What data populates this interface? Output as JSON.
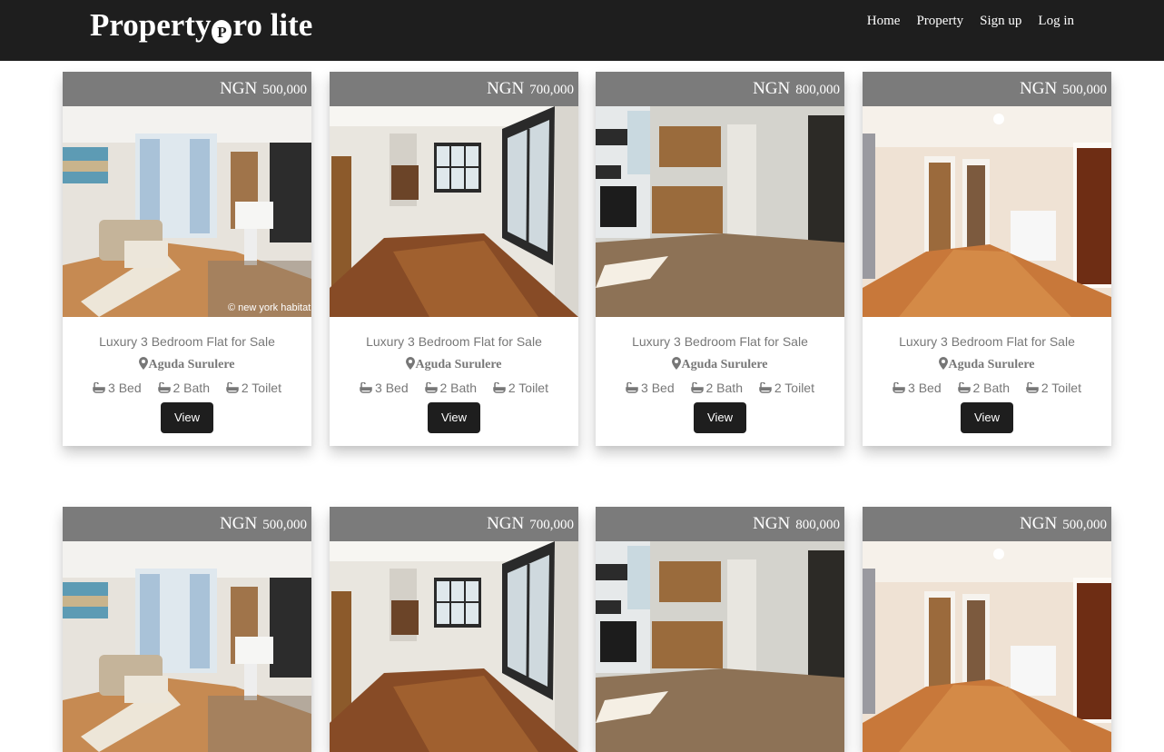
{
  "brand": {
    "before": "Property",
    "badge": "P",
    "after": "ro lite"
  },
  "nav": {
    "home": "Home",
    "property": "Property",
    "signup": "Sign up",
    "login": "Log in"
  },
  "colors": {
    "navbar": "#1e1e1e",
    "price_bar": "#7b7b7b",
    "text_muted": "#777777",
    "button": "#1e1e1e"
  },
  "listings": [
    {
      "currency": "NGN",
      "price": "500,000",
      "title": "Luxury 3 Bedroom Flat for Sale",
      "location": "Aguda Surulere",
      "bed": "3 Bed",
      "bath": "2 Bath",
      "toilet": "2 Toilet",
      "button": "View",
      "watermark": "© new york habitat"
    },
    {
      "currency": "NGN",
      "price": "700,000",
      "title": "Luxury 3 Bedroom Flat for Sale",
      "location": "Aguda Surulere",
      "bed": "3 Bed",
      "bath": "2 Bath",
      "toilet": "2 Toilet",
      "button": "View"
    },
    {
      "currency": "NGN",
      "price": "800,000",
      "title": "Luxury 3 Bedroom Flat for Sale",
      "location": "Aguda Surulere",
      "bed": "3 Bed",
      "bath": "2 Bath",
      "toilet": "2 Toilet",
      "button": "View"
    },
    {
      "currency": "NGN",
      "price": "500,000",
      "title": "Luxury 3 Bedroom Flat for Sale",
      "location": "Aguda Surulere",
      "bed": "3 Bed",
      "bath": "2 Bath",
      "toilet": "2 Toilet",
      "button": "View"
    },
    {
      "currency": "NGN",
      "price": "500,000"
    },
    {
      "currency": "NGN",
      "price": "700,000"
    },
    {
      "currency": "NGN",
      "price": "800,000"
    },
    {
      "currency": "NGN",
      "price": "500,000"
    }
  ]
}
